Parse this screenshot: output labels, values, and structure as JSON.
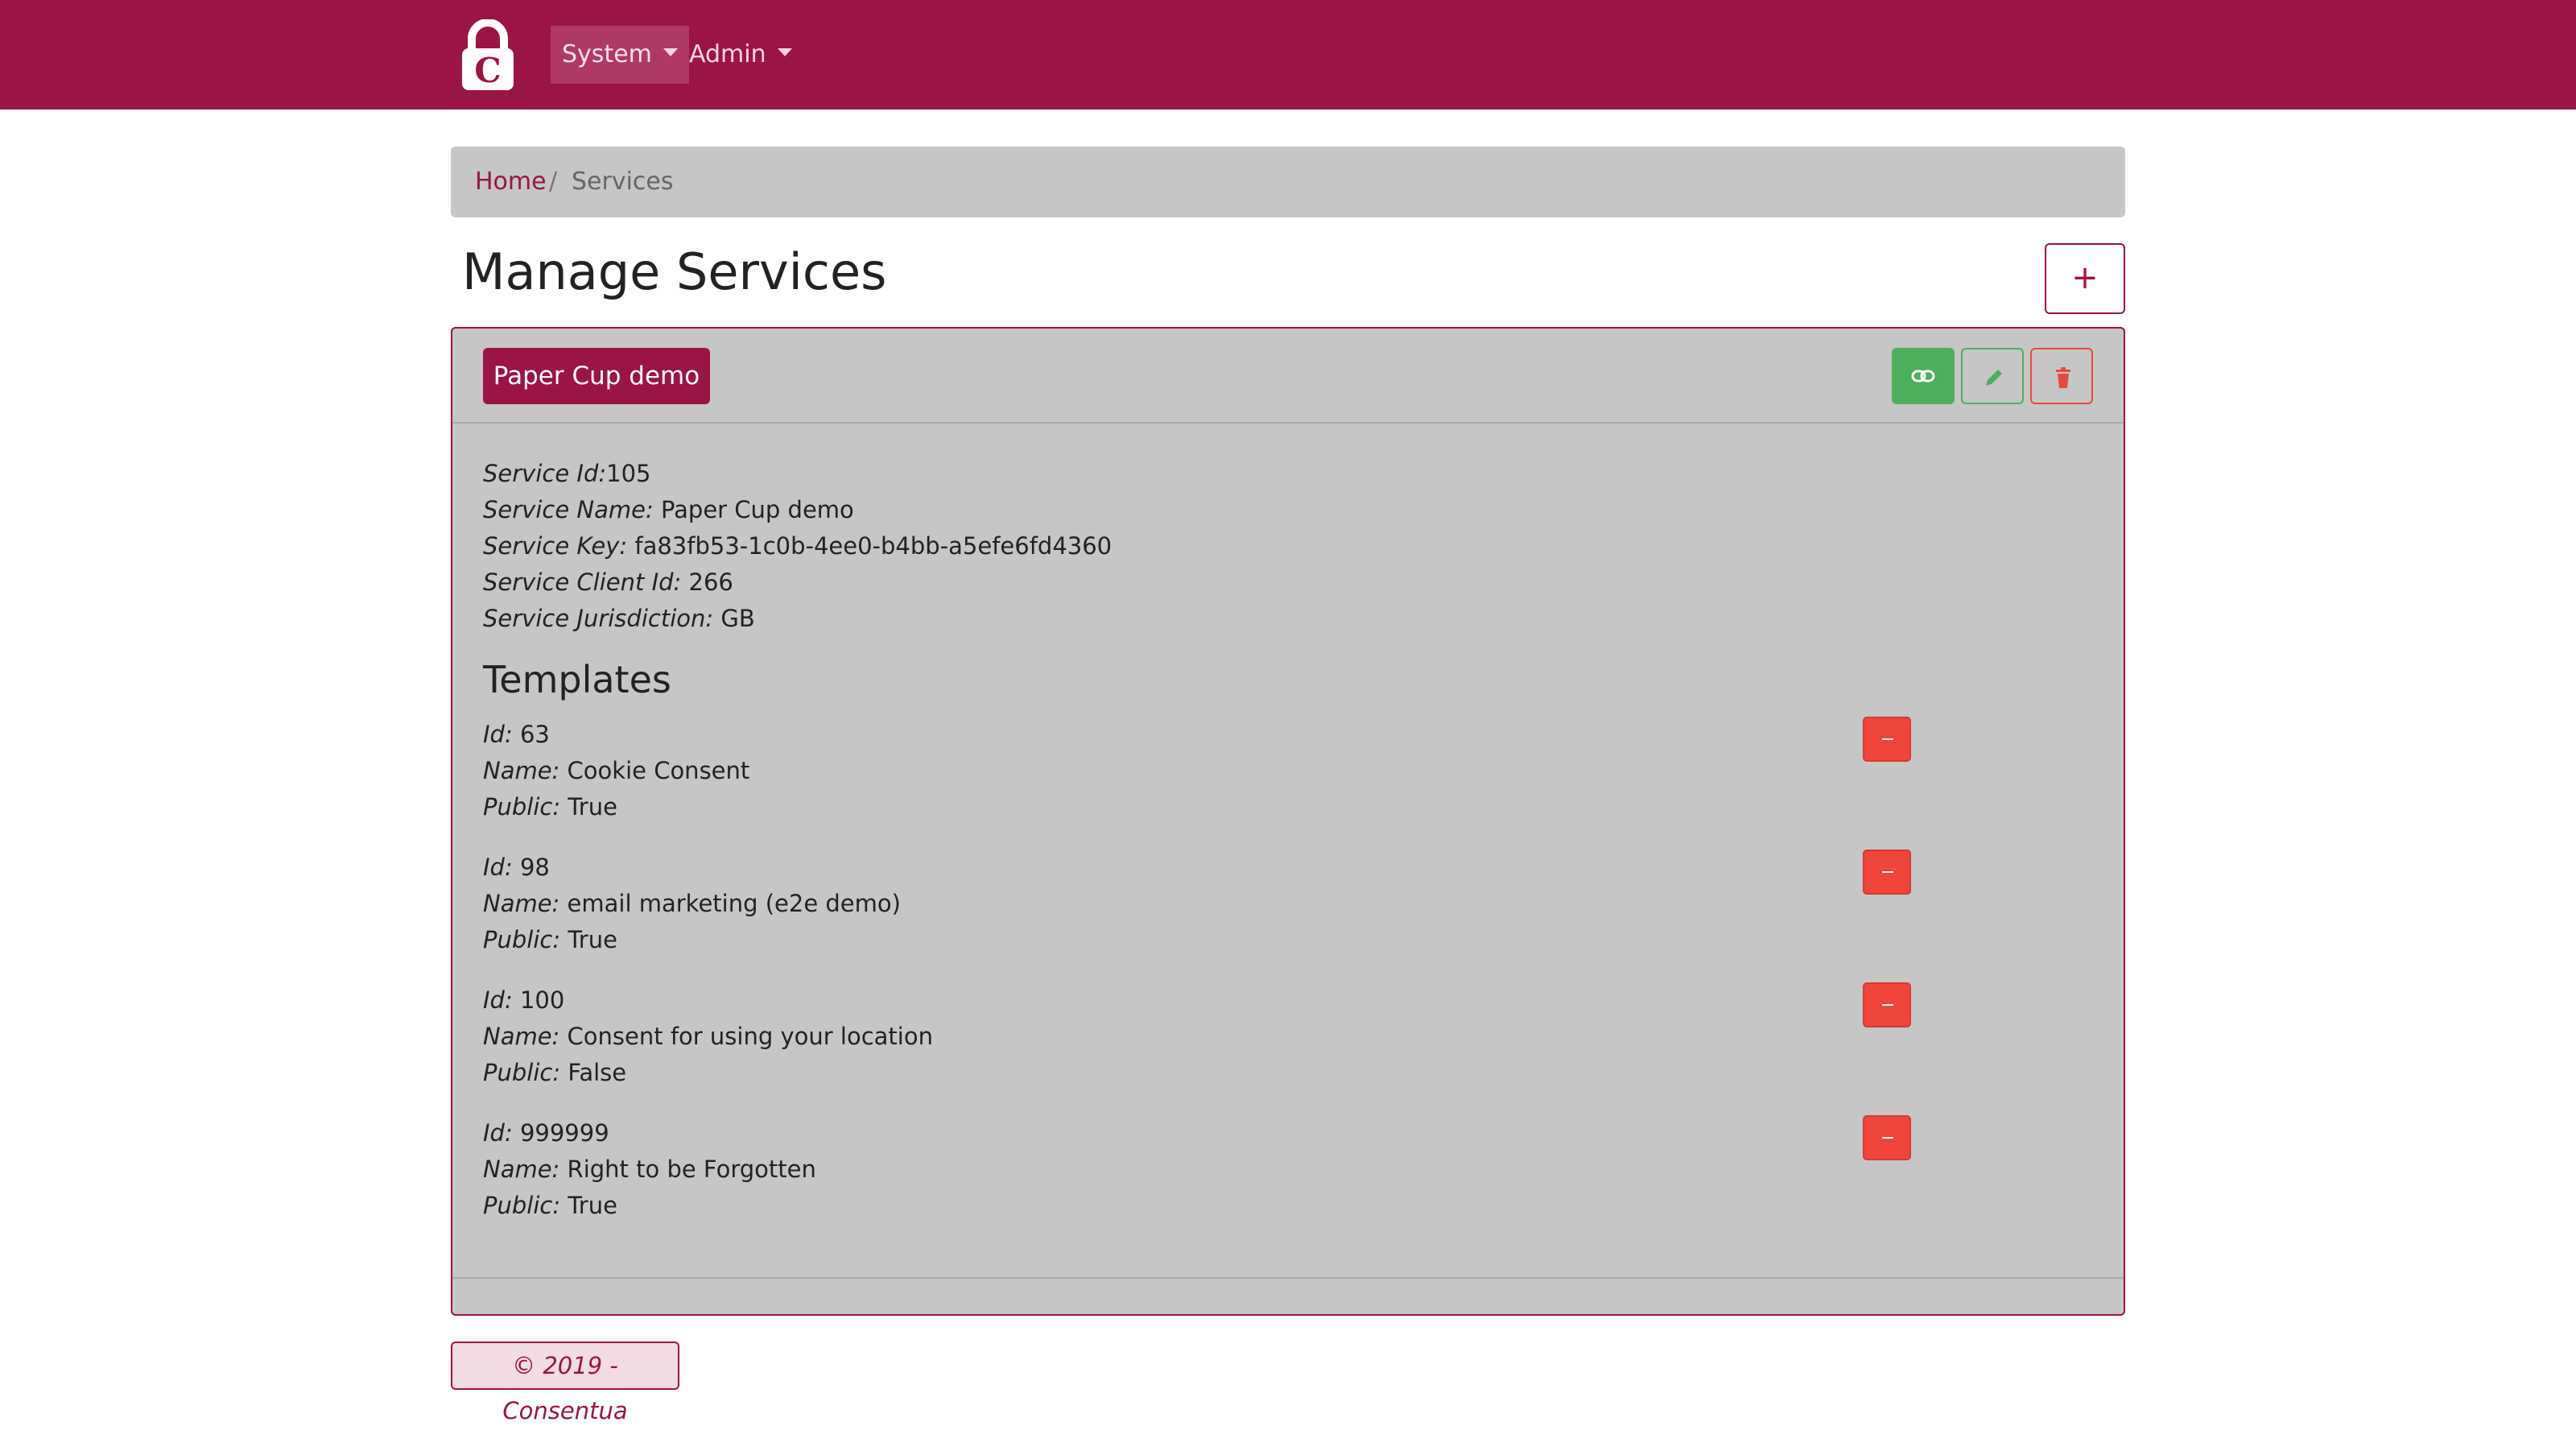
{
  "navbar": {
    "logo_letter": "C",
    "menu": [
      {
        "label": "System",
        "active": true
      },
      {
        "label": "Admin",
        "active": false
      }
    ]
  },
  "breadcrumb": {
    "home": "Home",
    "separator": "/",
    "current": "Services"
  },
  "page": {
    "title": "Manage Services",
    "add_button": "+"
  },
  "service": {
    "name_button": "Paper Cup demo",
    "actions": {
      "link_icon": "link-icon",
      "edit_icon": "pencil-icon",
      "delete_icon": "trash-icon"
    },
    "details": [
      {
        "label": "Service Id:",
        "value": "105"
      },
      {
        "label": "Service Name:",
        "value": " Paper Cup demo"
      },
      {
        "label": "Service Key:",
        "value": " fa83fb53-1c0b-4ee0-b4bb-a5efe6fd4360"
      },
      {
        "label": "Service Client Id:",
        "value": " 266"
      },
      {
        "label": "Service Jurisdiction:",
        "value": " GB"
      }
    ],
    "templates_title": "Templates",
    "templates": [
      {
        "id_label": "Id:",
        "id": " 63",
        "name_label": "Name:",
        "name": " Cookie Consent",
        "public_label": "Public:",
        "public": " True"
      },
      {
        "id_label": "Id:",
        "id": " 98",
        "name_label": "Name:",
        "name": " email marketing (e2e demo)",
        "public_label": "Public:",
        "public": " True"
      },
      {
        "id_label": "Id:",
        "id": " 100",
        "name_label": "Name:",
        "name": " Consent for using your location",
        "public_label": "Public:",
        "public": " False"
      },
      {
        "id_label": "Id:",
        "id": " 999999",
        "name_label": "Name:",
        "name": " Right to be Forgotten",
        "public_label": "Public:",
        "public": " True"
      }
    ]
  },
  "footer": {
    "text": "© 2019 - Consentua"
  },
  "colors": {
    "brand": "#9b1446",
    "success": "#4cb05c",
    "danger": "#f0453a",
    "panel": "#c6c6c6"
  }
}
